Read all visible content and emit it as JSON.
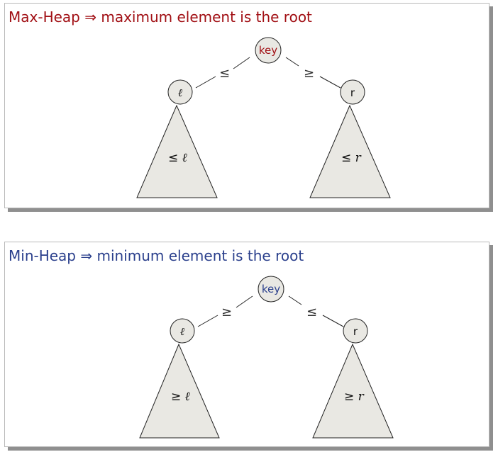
{
  "colors": {
    "max_accent": "#a10f14",
    "min_accent": "#2a3f8c",
    "node_fill": "#e9e8e3",
    "triangle_fill": "#e9e8e3",
    "stroke": "#222222"
  },
  "panels": [
    {
      "id": "max",
      "title": "Max-Heap ⇒ maximum element is the root",
      "root_label": "key",
      "left_label": "ℓ",
      "right_label": "r",
      "left_edge_rel": "≤",
      "right_edge_rel": "≥",
      "left_subtree_rel": "≤",
      "left_subtree_var": "ℓ",
      "right_subtree_rel": "≤",
      "right_subtree_var": "r"
    },
    {
      "id": "min",
      "title": "Min-Heap ⇒ minimum element is the root",
      "root_label": "key",
      "left_label": "ℓ",
      "right_label": "r",
      "left_edge_rel": "≥",
      "right_edge_rel": "≤",
      "left_subtree_rel": "≥",
      "left_subtree_var": "ℓ",
      "right_subtree_rel": "≥",
      "right_subtree_var": "r"
    }
  ]
}
